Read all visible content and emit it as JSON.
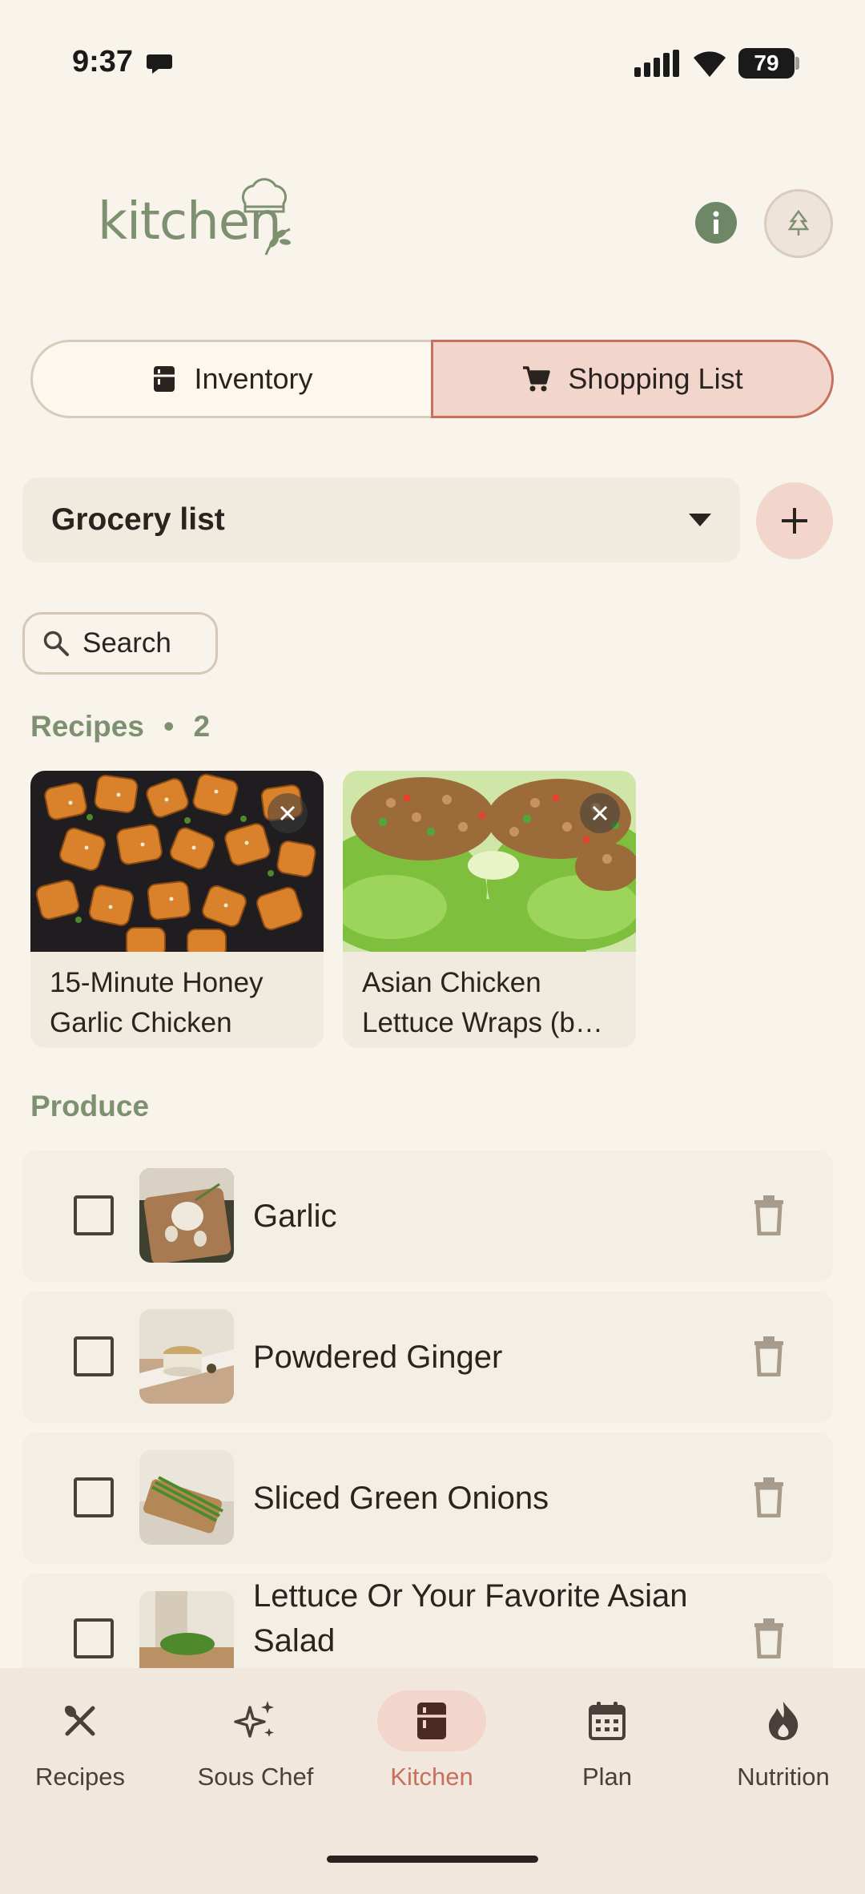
{
  "status_bar": {
    "time": "9:37",
    "battery": "79"
  },
  "header": {
    "logo_text": "kitchen"
  },
  "tabs": {
    "inventory": "Inventory",
    "shopping_list": "Shopping List"
  },
  "list_selector": {
    "selected": "Grocery list"
  },
  "search": {
    "label": "Search"
  },
  "recipes_section": {
    "title": "Recipes",
    "separator": "•",
    "count": "2"
  },
  "recipes": [
    {
      "title": "15-Minute Honey Garlic Chicken"
    },
    {
      "title": "Asian Chicken Lettuce Wraps (b…"
    }
  ],
  "produce_section": {
    "title": "Produce"
  },
  "items": [
    {
      "label": "Garlic"
    },
    {
      "label": "Powdered Ginger"
    },
    {
      "label": "Sliced Green Onions"
    },
    {
      "label": "Lettuce Or Your Favorite Asian Salad"
    }
  ],
  "bottom_nav": [
    {
      "label": "Recipes",
      "icon": "fork-knife-icon"
    },
    {
      "label": "Sous Chef",
      "icon": "sparkle-icon"
    },
    {
      "label": "Kitchen",
      "icon": "fridge-icon",
      "active": true
    },
    {
      "label": "Plan",
      "icon": "calendar-icon"
    },
    {
      "label": "Nutrition",
      "icon": "flame-icon"
    }
  ],
  "colors": {
    "background": "#f8f4ec",
    "accent": "#c8705f",
    "accent_soft": "#f2d6cc",
    "green": "#7d9070"
  }
}
